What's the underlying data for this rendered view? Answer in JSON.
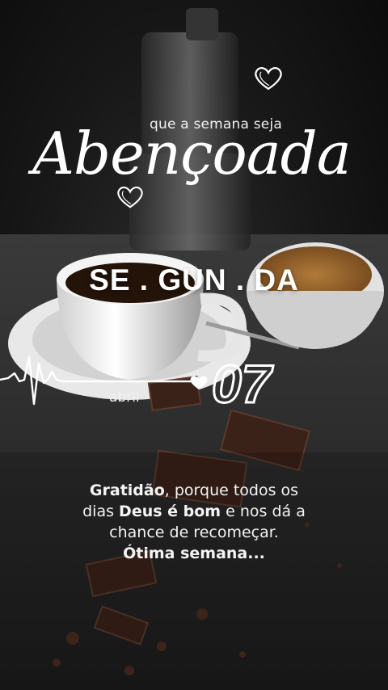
{
  "header": {
    "subtitle": "que a semana seja",
    "script_word": "Abençoada"
  },
  "weekday": "SE . GUN . DA",
  "date": {
    "month": "abril",
    "day": "07"
  },
  "message": {
    "line1_bold": "Gratidão",
    "line1_rest": ", porque todos os",
    "line2_start": "dias ",
    "line2_bold": "Deus é bom",
    "line2_rest": " e nos dá a",
    "line3": "chance de recomeçar.",
    "line4_bold": "Ótima semana..."
  },
  "icons": {
    "top": "heart-outline-icon",
    "left": "heart-outline-icon",
    "date": "heart-filled-icon",
    "line": "heartbeat-line-icon"
  },
  "colors": {
    "text": "#ffffff",
    "background": "#161616",
    "coffee": "#2b1b10",
    "chocolate": "#3a2219"
  }
}
